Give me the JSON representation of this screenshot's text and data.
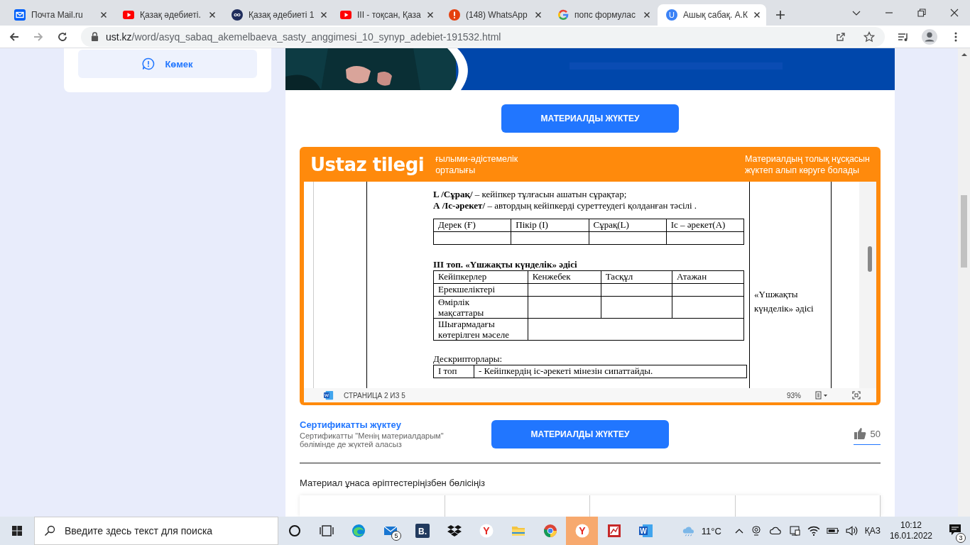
{
  "browser": {
    "tabs": [
      {
        "title": "Почта Mail.ru",
        "kind": "mail",
        "selected": false
      },
      {
        "title": "Қазақ әдебиеті.",
        "kind": "video",
        "selected": false
      },
      {
        "title": "Қазақ әдебиеті 1",
        "kind": "infinity",
        "selected": false
      },
      {
        "title": "ІІІ - тоқсан, Қаза",
        "kind": "video",
        "selected": false
      },
      {
        "title": "(148) WhatsApp",
        "kind": "alert",
        "selected": false
      },
      {
        "title": "попс формулас",
        "kind": "google",
        "selected": false
      },
      {
        "title": "Ашық сабақ. А.К",
        "kind": "letter",
        "icon_text": "U",
        "selected": true
      }
    ],
    "address": {
      "host": "ust.kz",
      "path": "/word/asyq_sabaq_akemelbaeva_sasty_anggimesi_10_synyp_adebiet-191532.html"
    }
  },
  "sidebar": {
    "help_button": "Көмек"
  },
  "content": {
    "download_top": "МАТЕРИАЛДЫ ЖҮКТЕУ",
    "viewer": {
      "brand": "Ustaz tilegi",
      "brand_subtitle": [
        "ғылыми-әдістемелік",
        "орталығы"
      ],
      "notice": [
        "Материалдың толық нұсқасын",
        "жүктеп алып көруге болады"
      ],
      "document": {
        "lines": [
          "**L /Сұрақ/** – кейіпкер тұлғасын ашатын сұрақтар;",
          "**А /Іс-әрекет/** – автордың кейіпкерді  суреттеудегі қолданған тәсілі ."
        ],
        "table_1": {
          "columns": [
            "Дерек  (Ғ)",
            "Пікір (І)",
            "Сұрақ(L)",
            "Іс – әрекет(А)"
          ]
        },
        "heading": "ІІІ топ. «Үшжақты күнделік» әдісі",
        "table_2": {
          "columns": [
            "Кейіпкерлер",
            "Кенжебек",
            "Тасқұл",
            "Атажан"
          ],
          "rows": [
            {
              "label": [
                "Ерекшеліктері"
              ],
              "merged": false
            },
            {
              "label": [
                "Өмірлік",
                "мақсаттары"
              ],
              "merged": false
            },
            {
              "label": [
                "Шығармадағы",
                "көтерілген мәселе"
              ],
              "merged": true
            }
          ]
        },
        "side_note": [
          "«Үшжақты",
          "күнделік» әдісі"
        ],
        "descriptors_title": "Дескрипторлары:",
        "descriptors": [
          {
            "group": "І топ",
            "text": "- Кейіпкердің іс-әрекеті мінезін сипаттайды."
          }
        ]
      },
      "status": {
        "page": "СТРАНИЦА 2 ИЗ 5",
        "zoom": "93%"
      }
    },
    "certificate": {
      "title": "Сертификатты жүктеу",
      "text": [
        "Сертификатты \"Менің материалдарым\"",
        "бөлімінде де жүктей аласыз"
      ]
    },
    "download_button": "МАТЕРИАЛДЫ ЖҮКТЕУ",
    "likes": "50",
    "share_prompt": "Материал ұнаса әріптестеріңізбен бөлісіңіз"
  },
  "taskbar": {
    "search_placeholder": "Введите здесь текст для поиска",
    "apps": [
      {
        "kind": "cortana",
        "selected": false
      },
      {
        "kind": "task-view",
        "selected": false
      },
      {
        "kind": "edge",
        "selected": false
      },
      {
        "kind": "mail",
        "badge": "5",
        "selected": false
      },
      {
        "kind": "square-letter",
        "text": "B.",
        "selected": false
      },
      {
        "kind": "dropbox",
        "selected": false
      },
      {
        "kind": "circle-letter",
        "text": "Y",
        "selected": false
      },
      {
        "kind": "folder",
        "selected": false
      },
      {
        "kind": "chrome",
        "selected": false
      },
      {
        "kind": "circle-letter",
        "text": "Y",
        "selected": true
      },
      {
        "kind": "chart",
        "selected": false
      },
      {
        "kind": "word",
        "text": "W",
        "selected": false
      }
    ],
    "temperature": "11°C",
    "language": "ҚАЗ",
    "time": "10:12",
    "date": "16.01.2022",
    "notifications": "3"
  }
}
